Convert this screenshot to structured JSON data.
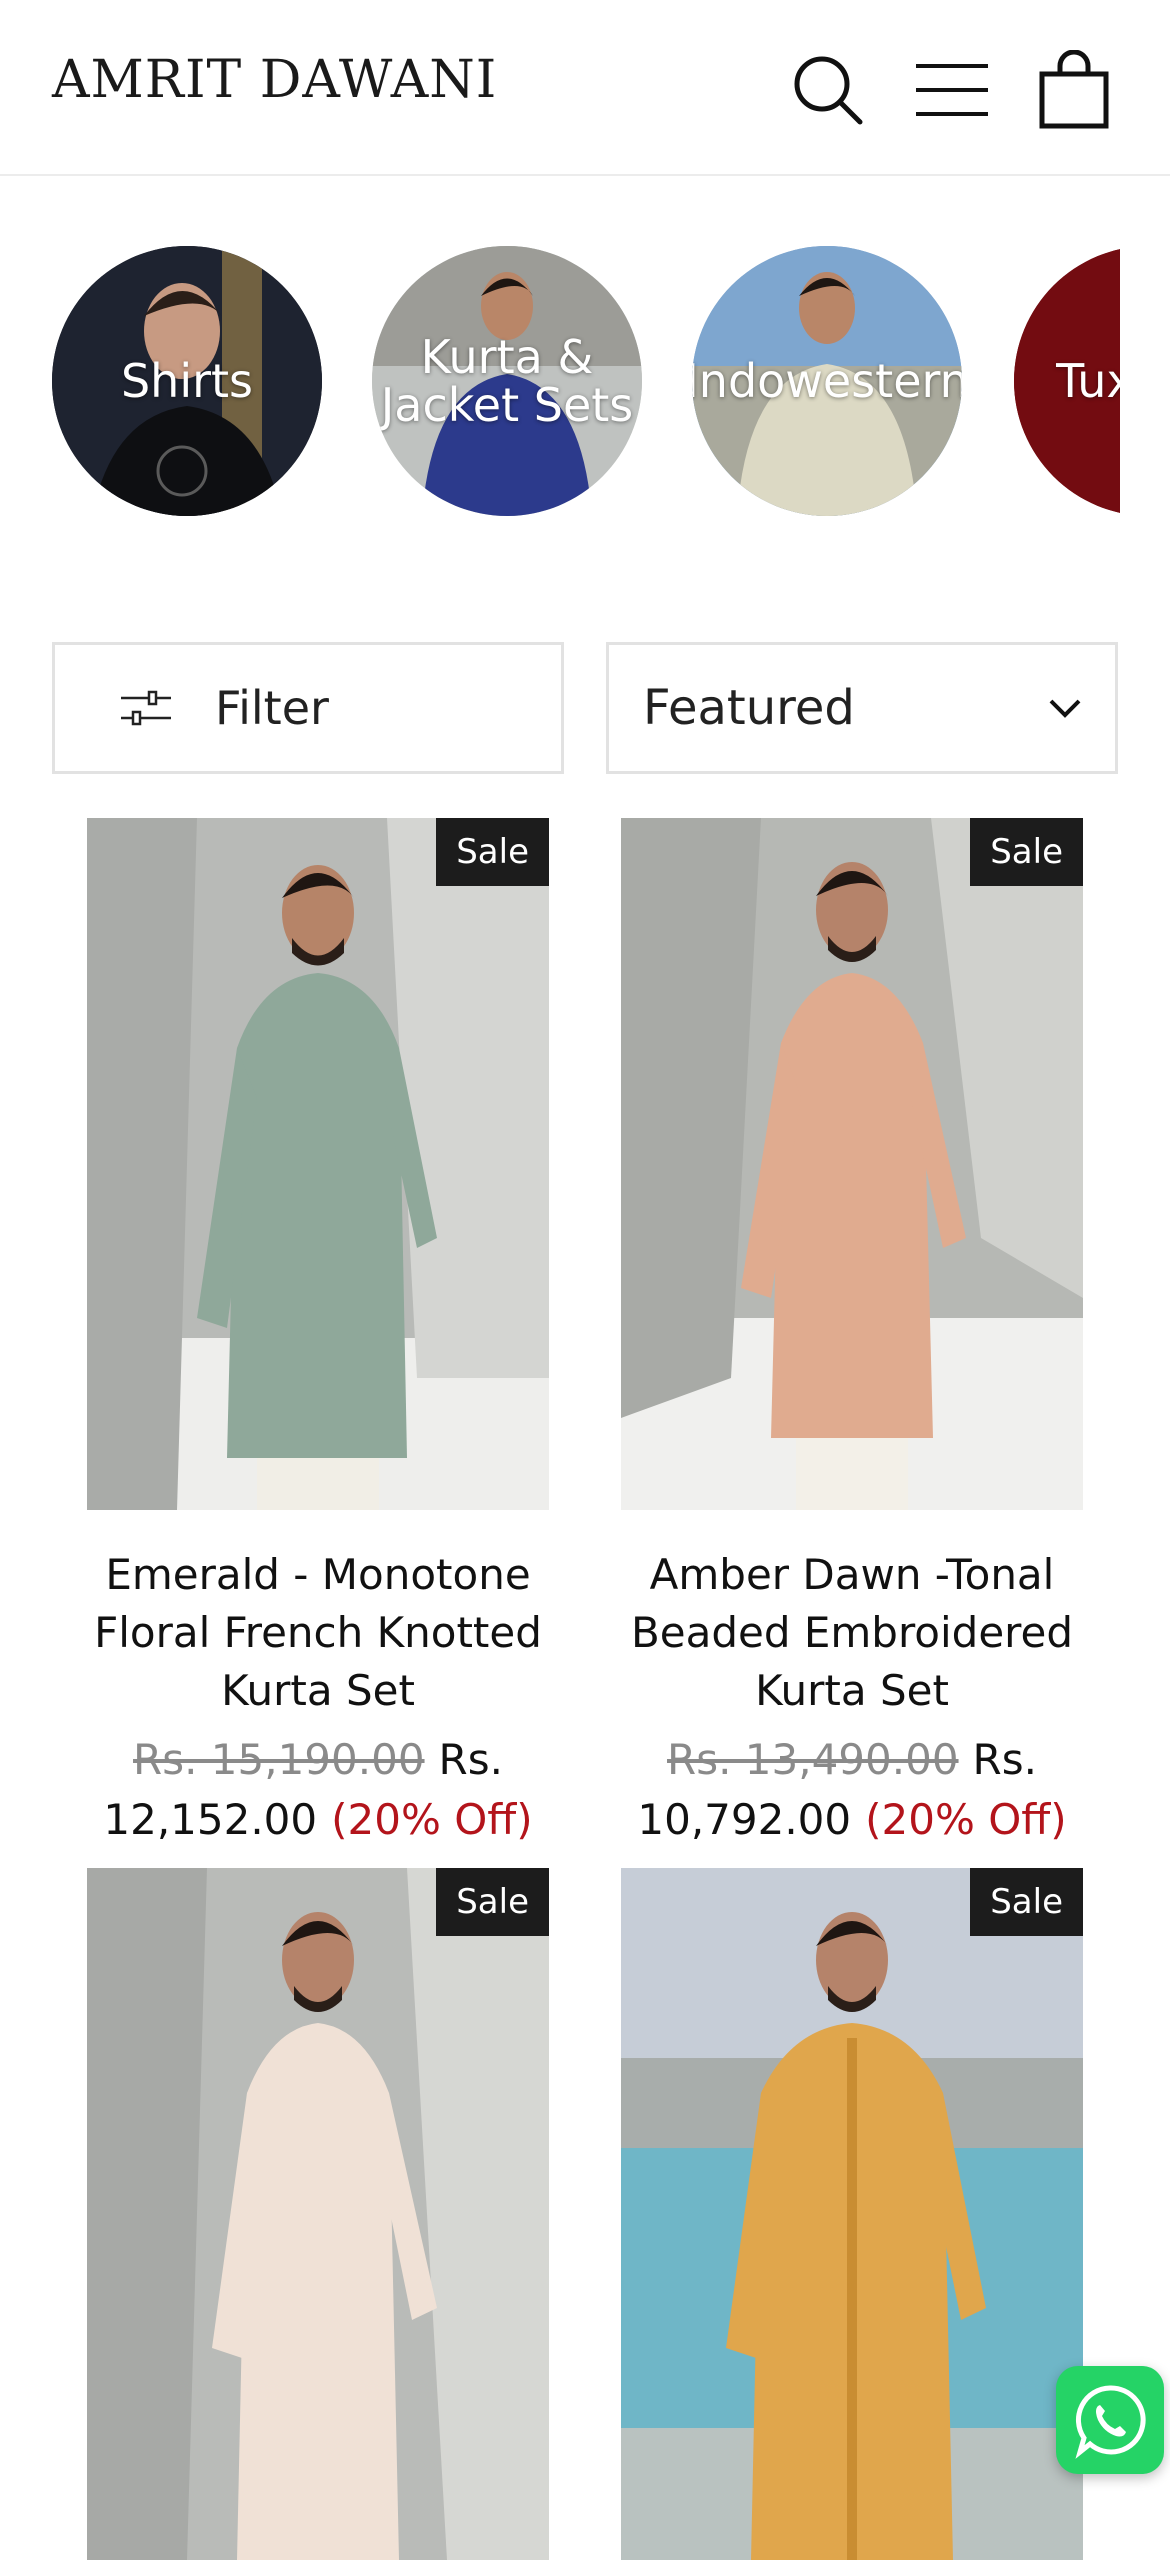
{
  "header": {
    "logo": "AMRIT DAWANI",
    "icons": [
      "search-icon",
      "menu-icon",
      "cart-icon"
    ]
  },
  "collections": [
    {
      "label": "Shirts"
    },
    {
      "label": "Kurta & Jacket Sets"
    },
    {
      "label": "Indowestern"
    },
    {
      "label": "Tuxedos"
    }
  ],
  "toolbar": {
    "filter_label": "Filter",
    "sort_value": "Featured"
  },
  "products": [
    {
      "badge": "Sale",
      "title": "Emerald - Monotone Floral French Knotted Kurta Set",
      "old_price": "Rs. 15,190.00",
      "price": "Rs. 12,152.00",
      "discount": "(20% Off)",
      "garment_color": "#8fa89a"
    },
    {
      "badge": "Sale",
      "title": "Amber Dawn -Tonal Beaded Embroidered Kurta Set",
      "old_price": "Rs. 13,490.00",
      "price": "Rs. 10,792.00",
      "discount": "(20% Off)",
      "garment_color": "#e0ab8f"
    },
    {
      "badge": "Sale",
      "garment_color": "#f0e1d6"
    },
    {
      "badge": "Sale",
      "garment_color": "#e0a64c"
    }
  ],
  "colors": {
    "sale_badge_bg": "#1c1c1c",
    "discount": "#b3141b",
    "whatsapp": "#25d366"
  }
}
